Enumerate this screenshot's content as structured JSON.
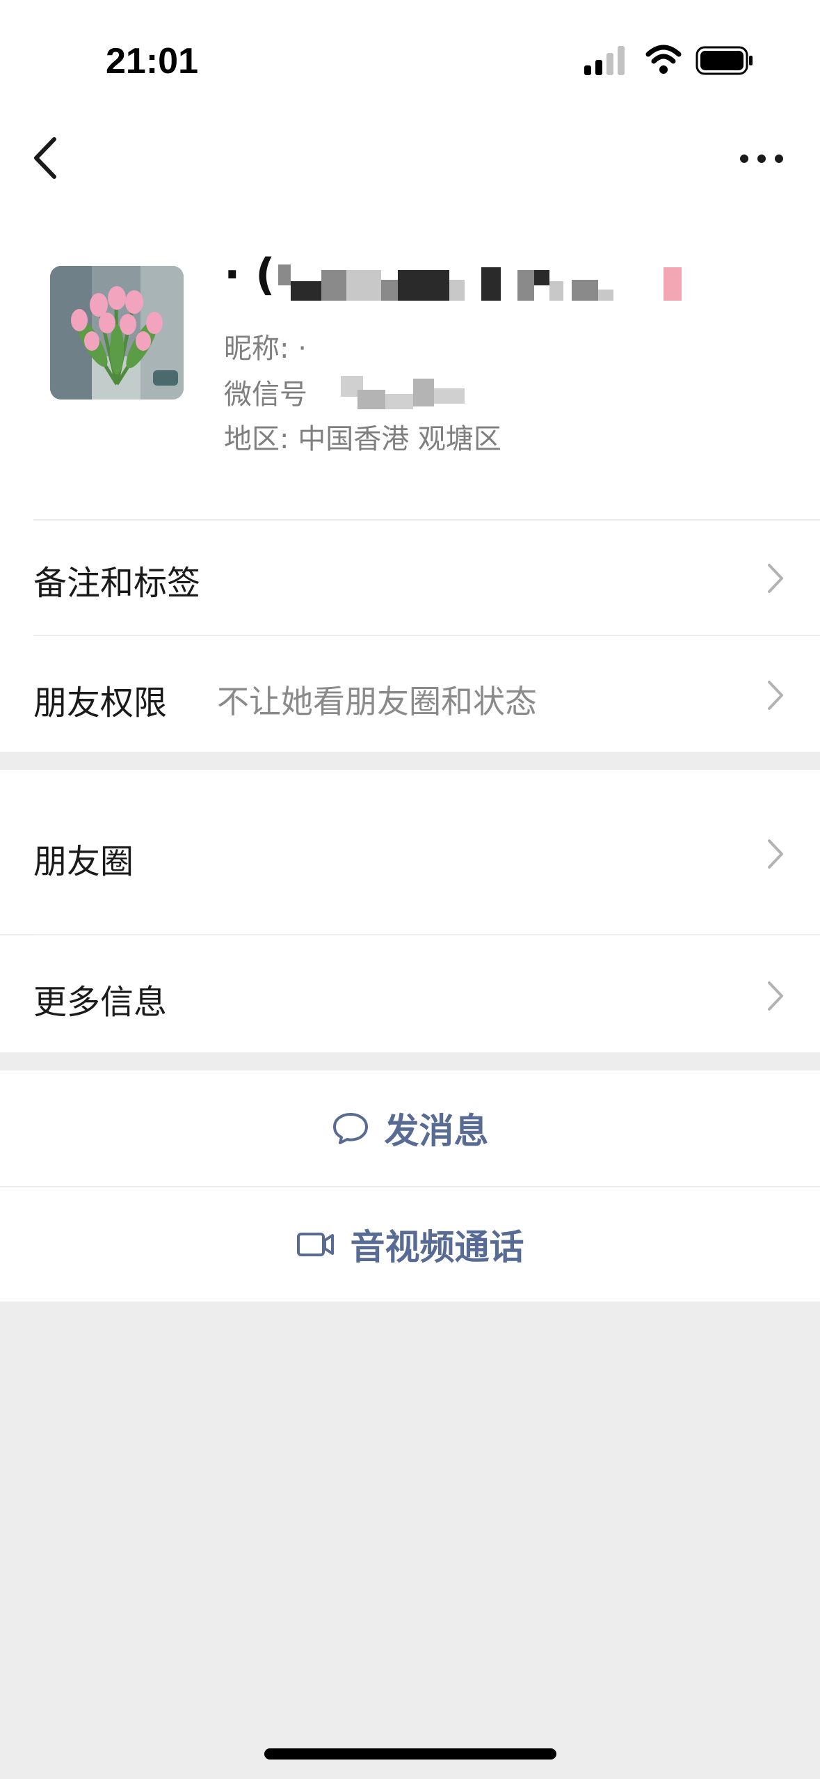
{
  "status_bar": {
    "time": "21:01"
  },
  "profile": {
    "name_prefix": "· (",
    "nickname_label": "昵称: ·",
    "wechat_id_label": "微信号",
    "region_text": "地区: 中国香港 观塘区"
  },
  "list": {
    "remarks_tags": "备注和标签",
    "friend_permissions": {
      "label": "朋友权限",
      "value": "不让她看朋友圈和状态"
    },
    "moments": "朋友圈",
    "more_info": "更多信息"
  },
  "actions": {
    "send_message": "发消息",
    "av_call": "音视频通话"
  },
  "icons": {
    "back": "chevron-left-icon",
    "more": "more-dots-icon",
    "chevron": "chevron-right-icon",
    "message": "chat-bubble-icon",
    "video": "video-camera-icon"
  },
  "colors": {
    "accent_link": "#576b95",
    "background": "#ededed",
    "secondary_text": "#8a8a8a"
  }
}
